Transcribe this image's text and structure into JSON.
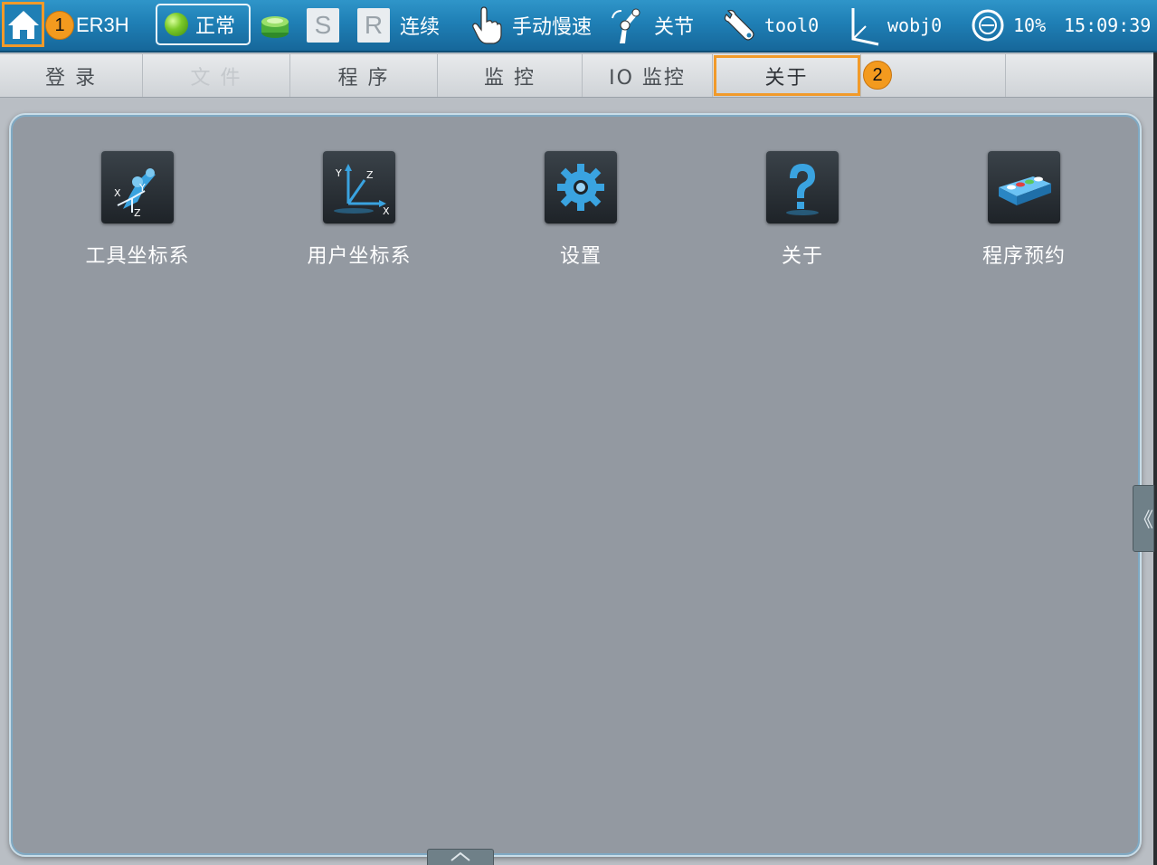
{
  "topbar": {
    "controller_name": "ER3H",
    "status_label": "正常",
    "servo_letter": "S",
    "run_letter": "R",
    "run_mode": "连续",
    "jog_mode": "手动慢速",
    "coord_mode": "关节",
    "tool": "tool0",
    "wobj": "wobj0",
    "speed": "10%",
    "time": "15:09:39"
  },
  "tabs": [
    {
      "label": "登 录",
      "enabled": true
    },
    {
      "label": "文 件",
      "enabled": false
    },
    {
      "label": "程 序",
      "enabled": true
    },
    {
      "label": "监 控",
      "enabled": true
    },
    {
      "label": "IO 监控",
      "enabled": true
    },
    {
      "label": "关于",
      "enabled": true,
      "highlighted": true
    }
  ],
  "apps": [
    {
      "label": "工具坐标系",
      "icon": "robot-arm-axes-icon"
    },
    {
      "label": "用户坐标系",
      "icon": "user-frame-axes-icon"
    },
    {
      "label": "设置",
      "icon": "gear-icon"
    },
    {
      "label": "关于",
      "icon": "question-mark-icon"
    },
    {
      "label": "程序预约",
      "icon": "block-lights-icon"
    }
  ],
  "callouts": [
    "1",
    "2"
  ],
  "side_handle_glyph": "《",
  "colors": {
    "topbar": "#1f7fb5",
    "panel": "#9399a1",
    "highlight": "#f19a2a"
  }
}
